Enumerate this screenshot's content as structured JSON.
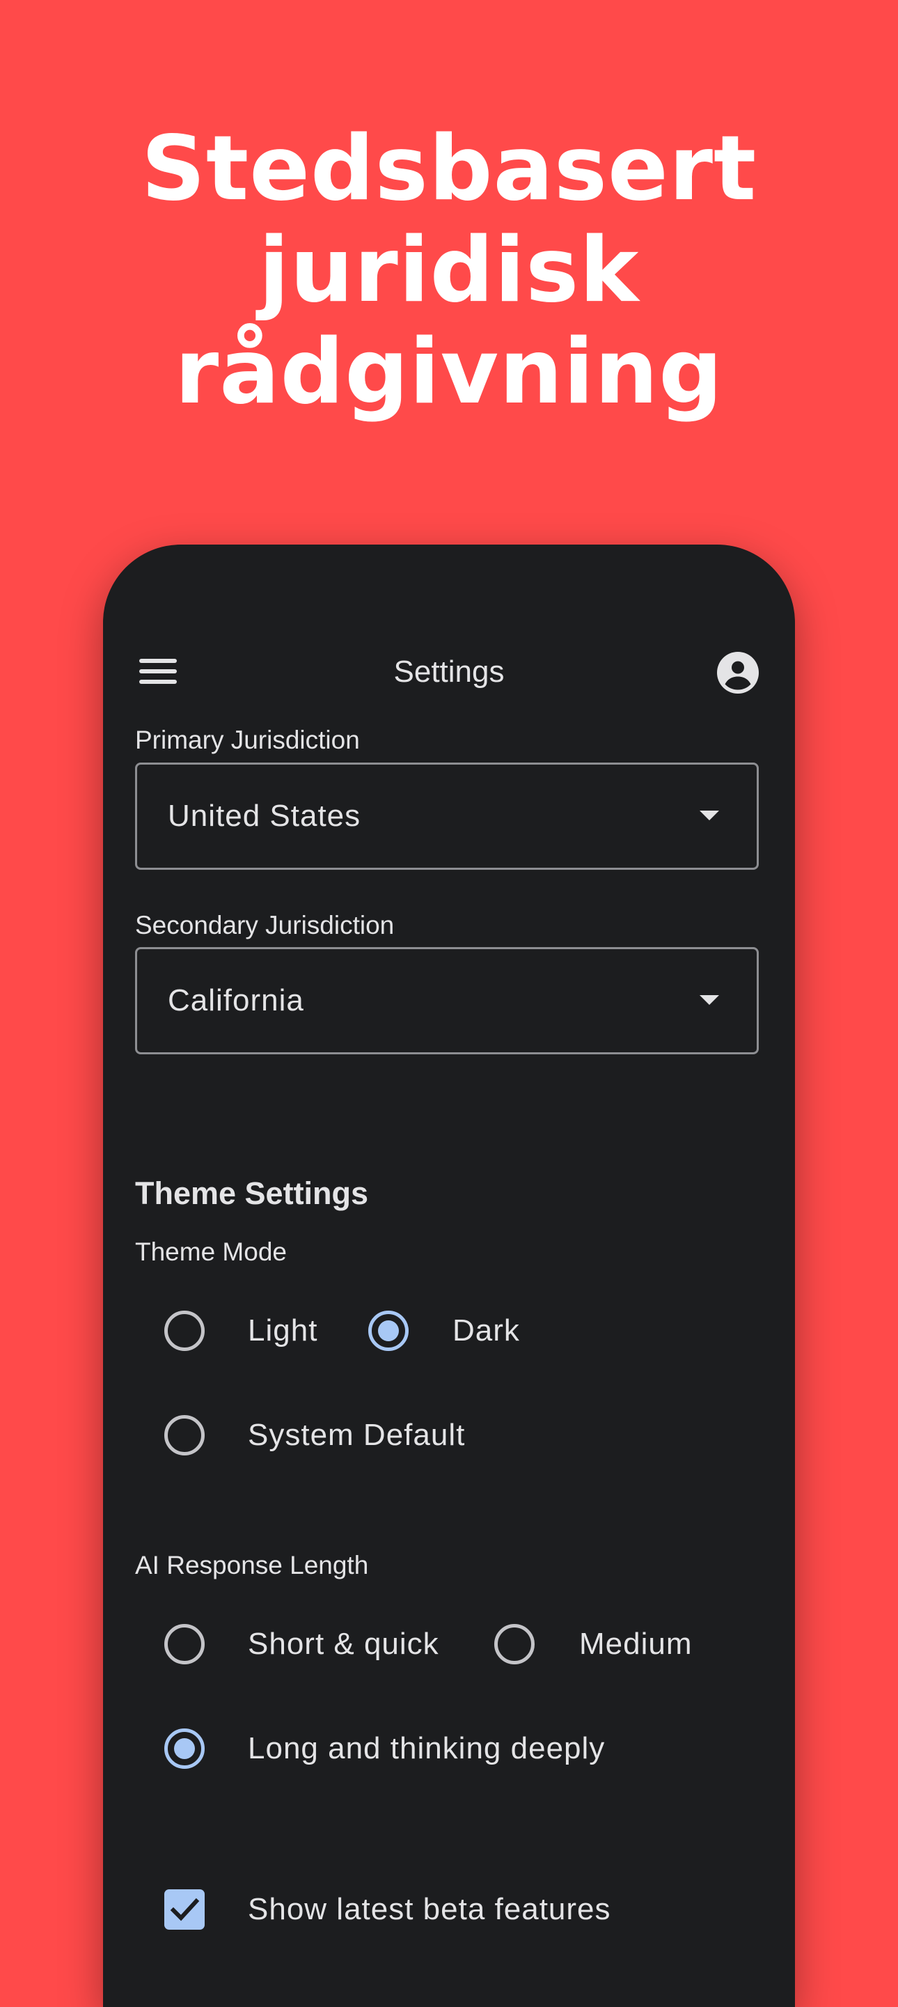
{
  "headline": {
    "line1": "Stedsbasert",
    "line2": "juridisk",
    "line3": "rådgivning"
  },
  "appbar": {
    "title": "Settings",
    "menu_icon": "hamburger-menu-icon",
    "account_icon": "account-circle-icon"
  },
  "jurisdiction": {
    "primary_label": "Primary Jurisdiction",
    "primary_value": "United States",
    "secondary_label": "Secondary Jurisdiction",
    "secondary_value": "California"
  },
  "theme": {
    "heading": "Theme Settings",
    "mode_label": "Theme Mode",
    "options": [
      {
        "label": "Light",
        "selected": false
      },
      {
        "label": "Dark",
        "selected": true
      },
      {
        "label": "System Default",
        "selected": false
      }
    ]
  },
  "response_length": {
    "label": "AI Response Length",
    "options": [
      {
        "label": "Short & quick",
        "selected": false
      },
      {
        "label": "Medium",
        "selected": false
      },
      {
        "label": "Long and thinking deeply",
        "selected": true
      }
    ]
  },
  "beta": {
    "label": "Show latest beta features",
    "checked": true
  },
  "colors": {
    "background": "#FF4A4A",
    "phone_surface": "#1C1D1F",
    "text": "#E4E4E6",
    "accent": "#A8C8F5",
    "outline": "#8D8E92"
  }
}
